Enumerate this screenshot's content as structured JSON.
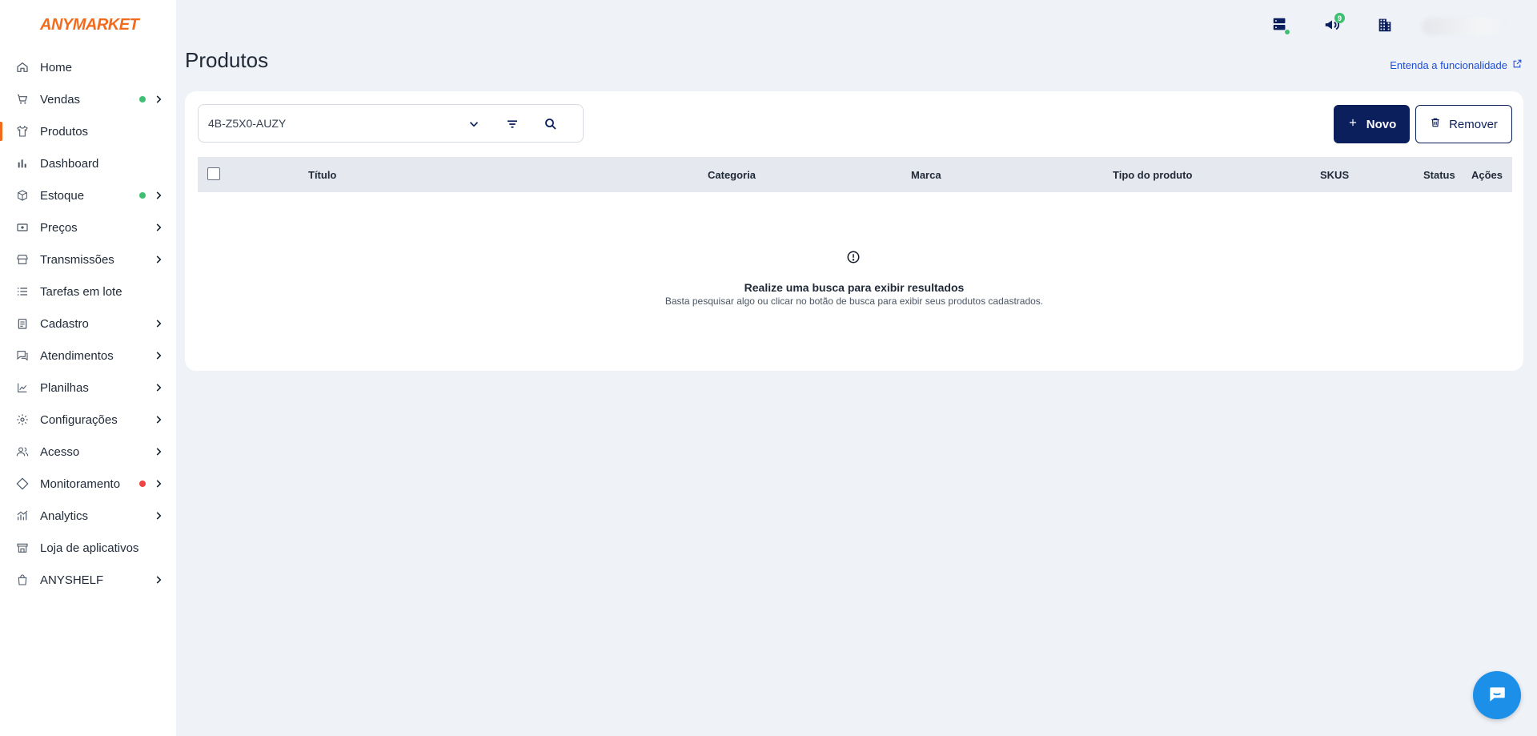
{
  "brand": {
    "logo_text": "ANYMARKET",
    "accent_color": "#f26b1d",
    "primary_color": "#0b1f5c"
  },
  "sidebar": {
    "items": [
      {
        "label": "Home",
        "icon": "home-icon",
        "dot": null,
        "chevron": false,
        "active": false
      },
      {
        "label": "Vendas",
        "icon": "cart-icon",
        "dot": "green",
        "chevron": true,
        "active": false
      },
      {
        "label": "Produtos",
        "icon": "shirt-icon",
        "dot": null,
        "chevron": false,
        "active": true
      },
      {
        "label": "Dashboard",
        "icon": "bar-chart-icon",
        "dot": null,
        "chevron": false,
        "active": false
      },
      {
        "label": "Estoque",
        "icon": "box-icon",
        "dot": "green",
        "chevron": true,
        "active": false
      },
      {
        "label": "Preços",
        "icon": "money-icon",
        "dot": null,
        "chevron": true,
        "active": false
      },
      {
        "label": "Transmissões",
        "icon": "store-icon",
        "dot": null,
        "chevron": true,
        "active": false
      },
      {
        "label": "Tarefas em lote",
        "icon": "list-icon",
        "dot": null,
        "chevron": false,
        "active": false
      },
      {
        "label": "Cadastro",
        "icon": "clipboard-icon",
        "dot": null,
        "chevron": true,
        "active": false
      },
      {
        "label": "Atendimentos",
        "icon": "chat-icon",
        "dot": null,
        "chevron": true,
        "active": false
      },
      {
        "label": "Planilhas",
        "icon": "spreadsheet-icon",
        "dot": null,
        "chevron": true,
        "active": false
      },
      {
        "label": "Configurações",
        "icon": "gear-icon",
        "dot": null,
        "chevron": true,
        "active": false
      },
      {
        "label": "Acesso",
        "icon": "users-icon",
        "dot": null,
        "chevron": true,
        "active": false
      },
      {
        "label": "Monitoramento",
        "icon": "diamond-icon",
        "dot": "red",
        "chevron": true,
        "active": false
      },
      {
        "label": "Analytics",
        "icon": "analytics-icon",
        "dot": null,
        "chevron": true,
        "active": false
      },
      {
        "label": "Loja de aplicativos",
        "icon": "storefront-icon",
        "dot": null,
        "chevron": false,
        "active": false
      },
      {
        "label": "ANYSHELF",
        "icon": "bag-icon",
        "dot": null,
        "chevron": true,
        "active": false
      }
    ]
  },
  "topbar": {
    "notifications_count": "9",
    "icons": [
      "server-status-icon",
      "megaphone-icon",
      "building-icon"
    ]
  },
  "page": {
    "title": "Produtos",
    "help_link": "Entenda a funcionalidade"
  },
  "search": {
    "value": "4B-Z5X0-AUZY"
  },
  "actions": {
    "new_label": "Novo",
    "remove_label": "Remover"
  },
  "table": {
    "columns": [
      "Título",
      "Categoria",
      "Marca",
      "Tipo do produto",
      "SKUS",
      "Status",
      "Ações"
    ]
  },
  "empty_state": {
    "title": "Realize uma busca para exibir resultados",
    "subtitle": "Basta pesquisar algo ou clicar no botão de busca para exibir seus produtos cadastrados."
  }
}
